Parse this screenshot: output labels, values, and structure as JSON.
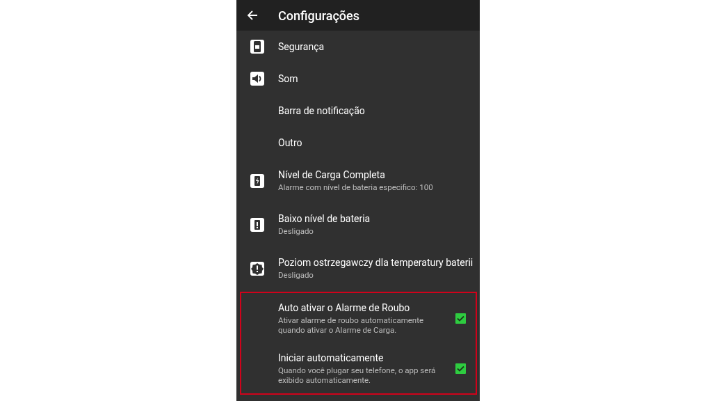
{
  "app_bar": {
    "title": "Configurações"
  },
  "items": [
    {
      "kind": "header",
      "title": "Segurança"
    },
    {
      "kind": "header",
      "title": "Som"
    },
    {
      "kind": "header",
      "title": "Barra de notificação"
    },
    {
      "kind": "header",
      "title": "Outro"
    },
    {
      "kind": "setting",
      "title": "Nível de Carga Completa",
      "summary": "Alarme com nível de bateria especifico: 100"
    },
    {
      "kind": "setting",
      "title": "Baixo nível de bateria",
      "summary": "Desligado"
    },
    {
      "kind": "setting",
      "title": "Poziom ostrzegawczy dla temperatury baterii",
      "summary": "Desligado"
    }
  ],
  "highlight_box": {
    "items": [
      {
        "kind": "checkbox",
        "title": "Auto ativar o Alarme de Roubo",
        "summary": "Ativar alarme de roubo automaticamente quando ativar o Alarme de Carga.",
        "checked": true
      },
      {
        "kind": "checkbox",
        "title": "Iniciar automaticamente",
        "summary": "Quando você plugar seu telefone, o app será exibido automaticamente.",
        "checked": true
      }
    ]
  }
}
